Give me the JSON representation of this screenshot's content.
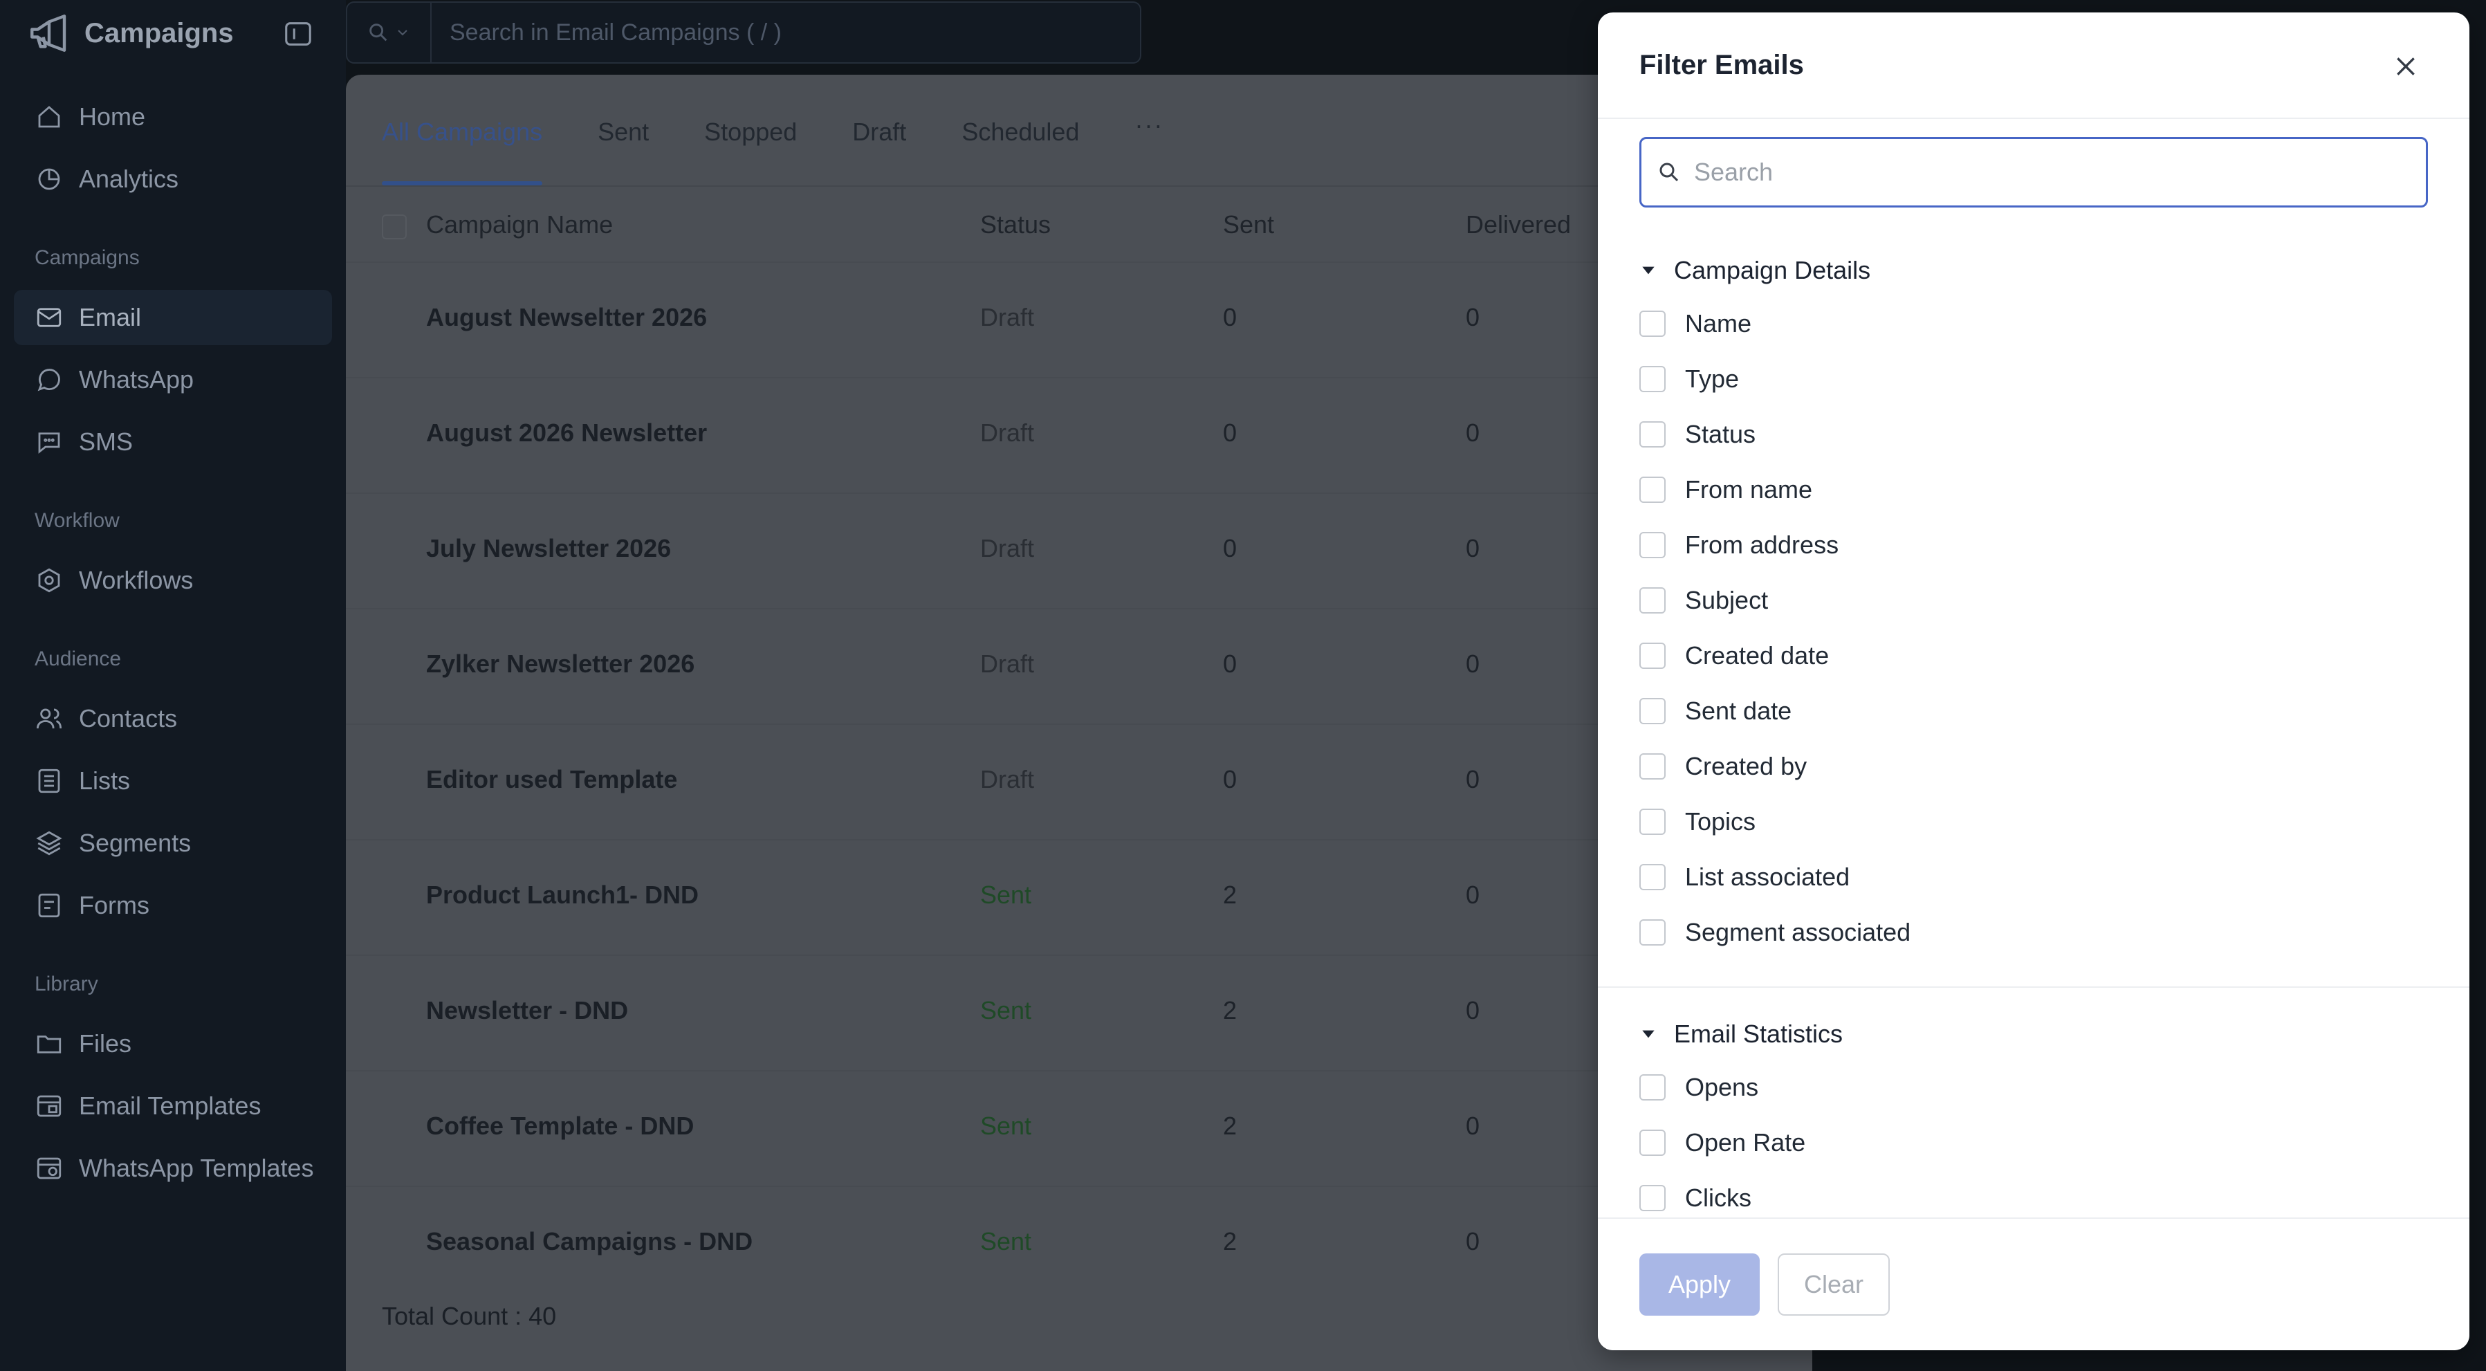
{
  "app": {
    "name": "Campaigns"
  },
  "top_search": {
    "placeholder": "Search in Email Campaigns ( / )"
  },
  "sidebar": {
    "home": "Home",
    "analytics": "Analytics",
    "section_campaigns": "Campaigns",
    "email": "Email",
    "whatsapp": "WhatsApp",
    "sms": "SMS",
    "section_workflow": "Workflow",
    "workflows": "Workflows",
    "section_audience": "Audience",
    "contacts": "Contacts",
    "lists": "Lists",
    "segments": "Segments",
    "forms": "Forms",
    "section_library": "Library",
    "files": "Files",
    "email_templates": "Email Templates",
    "whatsapp_templates": "WhatsApp Templates"
  },
  "tabs": {
    "all": "All Campaigns",
    "sent": "Sent",
    "stopped": "Stopped",
    "draft": "Draft",
    "scheduled": "Scheduled",
    "more": "···"
  },
  "table": {
    "columns": {
      "name": "Campaign Name",
      "status": "Status",
      "sent": "Sent",
      "delivered": "Delivered"
    },
    "rows": [
      {
        "name": "August Newseltter 2026",
        "status": "Draft",
        "sent": "0",
        "delivered": "0"
      },
      {
        "name": "August 2026 Newsletter",
        "status": "Draft",
        "sent": "0",
        "delivered": "0"
      },
      {
        "name": "July Newsletter 2026",
        "status": "Draft",
        "sent": "0",
        "delivered": "0"
      },
      {
        "name": "Zylker Newsletter 2026",
        "status": "Draft",
        "sent": "0",
        "delivered": "0"
      },
      {
        "name": "Editor used Template",
        "status": "Draft",
        "sent": "0",
        "delivered": "0"
      },
      {
        "name": "Product Launch1- DND",
        "status": "Sent",
        "sent": "2",
        "delivered": "0"
      },
      {
        "name": "Newsletter - DND",
        "status": "Sent",
        "sent": "2",
        "delivered": "0"
      },
      {
        "name": "Coffee Template - DND",
        "status": "Sent",
        "sent": "2",
        "delivered": "0"
      },
      {
        "name": "Seasonal Campaigns - DND",
        "status": "Sent",
        "sent": "2",
        "delivered": "0"
      }
    ],
    "total": "Total Count : 40"
  },
  "modal": {
    "title": "Filter Emails",
    "search_placeholder": "Search",
    "campaign_details": {
      "title": "Campaign Details",
      "options": [
        "Name",
        "Type",
        "Status",
        "From name",
        "From address",
        "Subject",
        "Created date",
        "Sent date",
        "Created by",
        "Topics",
        "List associated",
        "Segment associated"
      ]
    },
    "email_statistics": {
      "title": "Email Statistics",
      "options": [
        "Opens",
        "Open Rate",
        "Clicks"
      ]
    },
    "apply": "Apply",
    "clear": "Clear"
  },
  "colors": {
    "sidebar_bg": "#121922",
    "accent": "#4766c6",
    "apply_disabled": "#a9b7e6",
    "status_sent": "#1f4a27"
  }
}
